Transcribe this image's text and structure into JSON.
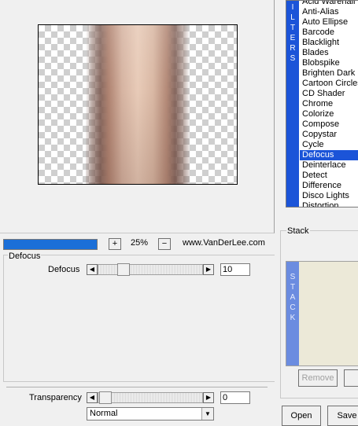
{
  "filters": {
    "strip_label": [
      "I",
      "L",
      "T",
      "E",
      "R",
      "S"
    ],
    "items": [
      "Acid Warehall",
      "Anti-Alias",
      "Auto Ellipse",
      "Barcode",
      "Blacklight",
      "Blades",
      "Blobspike",
      "Brighten Dark",
      "Cartoon Circles",
      "CD Shader",
      "Chrome",
      "Colorize",
      "Compose",
      "Copystar",
      "Cycle",
      "Defocus",
      "Deinterlace",
      "Detect",
      "Difference",
      "Disco Lights",
      "Distortion"
    ],
    "selected": "Defocus"
  },
  "toolbar": {
    "zoom_in_label": "+",
    "zoom_value": "25%",
    "zoom_out_label": "−",
    "website": "www.VanDerLee.com"
  },
  "defocus": {
    "group_title": "Defocus",
    "param_label": "Defocus",
    "value": "10"
  },
  "bottom": {
    "transparency_label": "Transparency",
    "transparency_value": "0",
    "blend_mode": "Normal"
  },
  "stack": {
    "title": "Stack",
    "strip_label": [
      "S",
      "T",
      "A",
      "C",
      "K"
    ],
    "remove_label": "Remove",
    "open_label": "Open",
    "save_label": "Save"
  },
  "colors": {
    "accent": "#1b54d8",
    "stack_strip": "#6b8ce0",
    "stack_bg": "#ece9d8"
  }
}
